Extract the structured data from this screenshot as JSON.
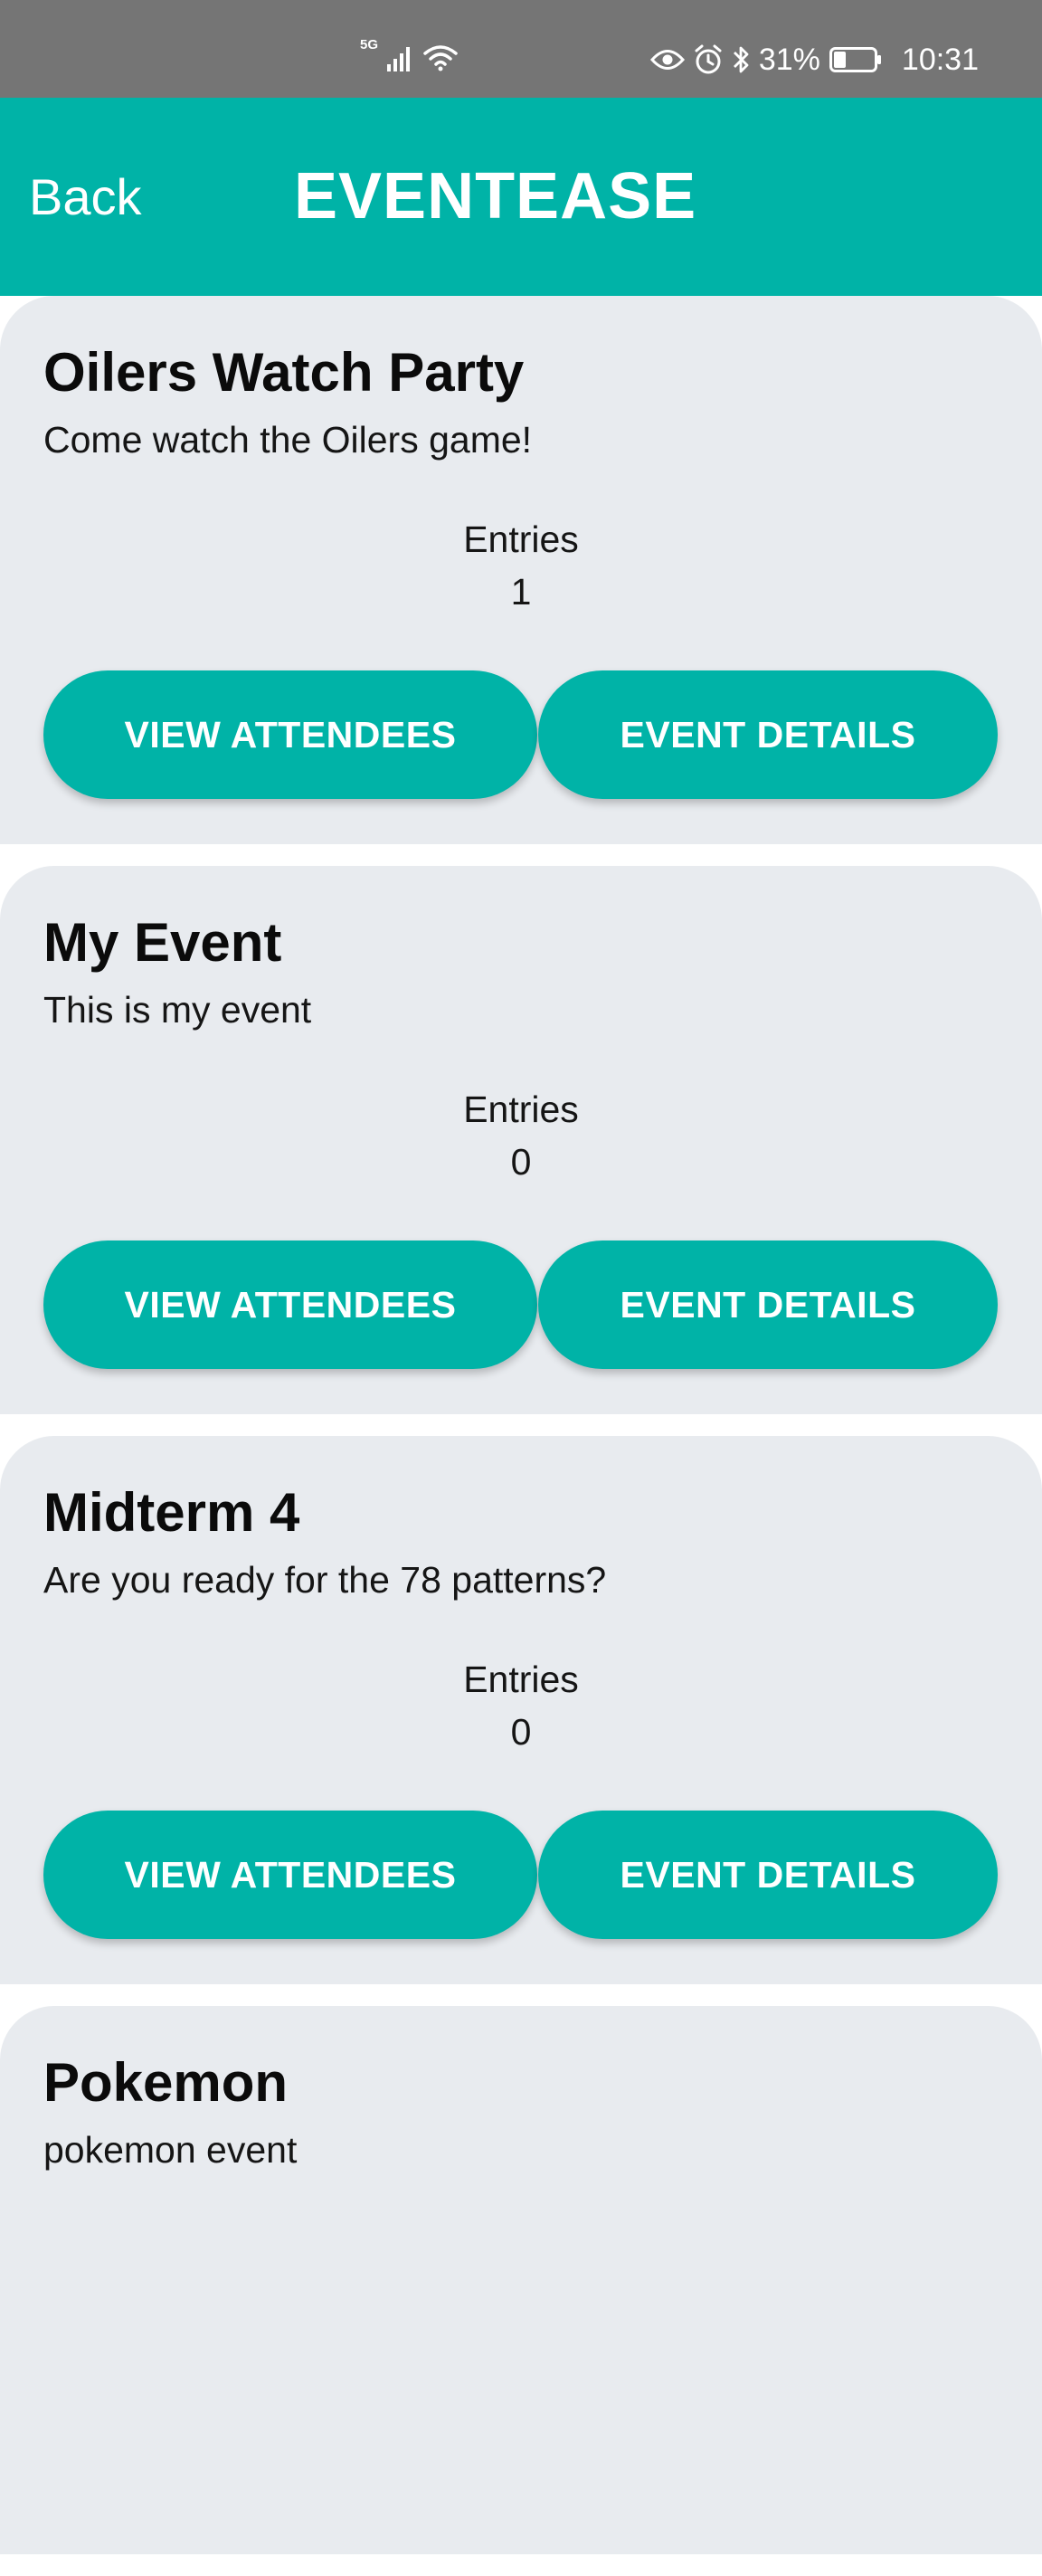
{
  "status_bar": {
    "network_label": "5G",
    "battery_percent": "31%",
    "time": "10:31",
    "battery_level": 0.31,
    "icons": [
      "signal-icon",
      "wifi-icon",
      "eye-icon",
      "alarm-icon",
      "bluetooth-icon",
      "battery-icon"
    ]
  },
  "app_bar": {
    "back_label": "Back",
    "title": "EVENTEASE",
    "color": "#00b3a7"
  },
  "events": [
    {
      "title": "Oilers Watch Party",
      "description": "Come watch the Oilers game!",
      "entries_label": "Entries",
      "entries_count": "1",
      "attendees_label": "VIEW ATTENDEES",
      "details_label": "EVENT DETAILS"
    },
    {
      "title": "My Event",
      "description": "This is my event",
      "entries_label": "Entries",
      "entries_count": "0",
      "attendees_label": "VIEW ATTENDEES",
      "details_label": "EVENT DETAILS"
    },
    {
      "title": "Midterm 4",
      "description": "Are you ready for the 78 patterns?",
      "entries_label": "Entries",
      "entries_count": "0",
      "attendees_label": "VIEW ATTENDEES",
      "details_label": "EVENT DETAILS"
    },
    {
      "title": "Pokemon",
      "description": "pokemon event"
    }
  ]
}
